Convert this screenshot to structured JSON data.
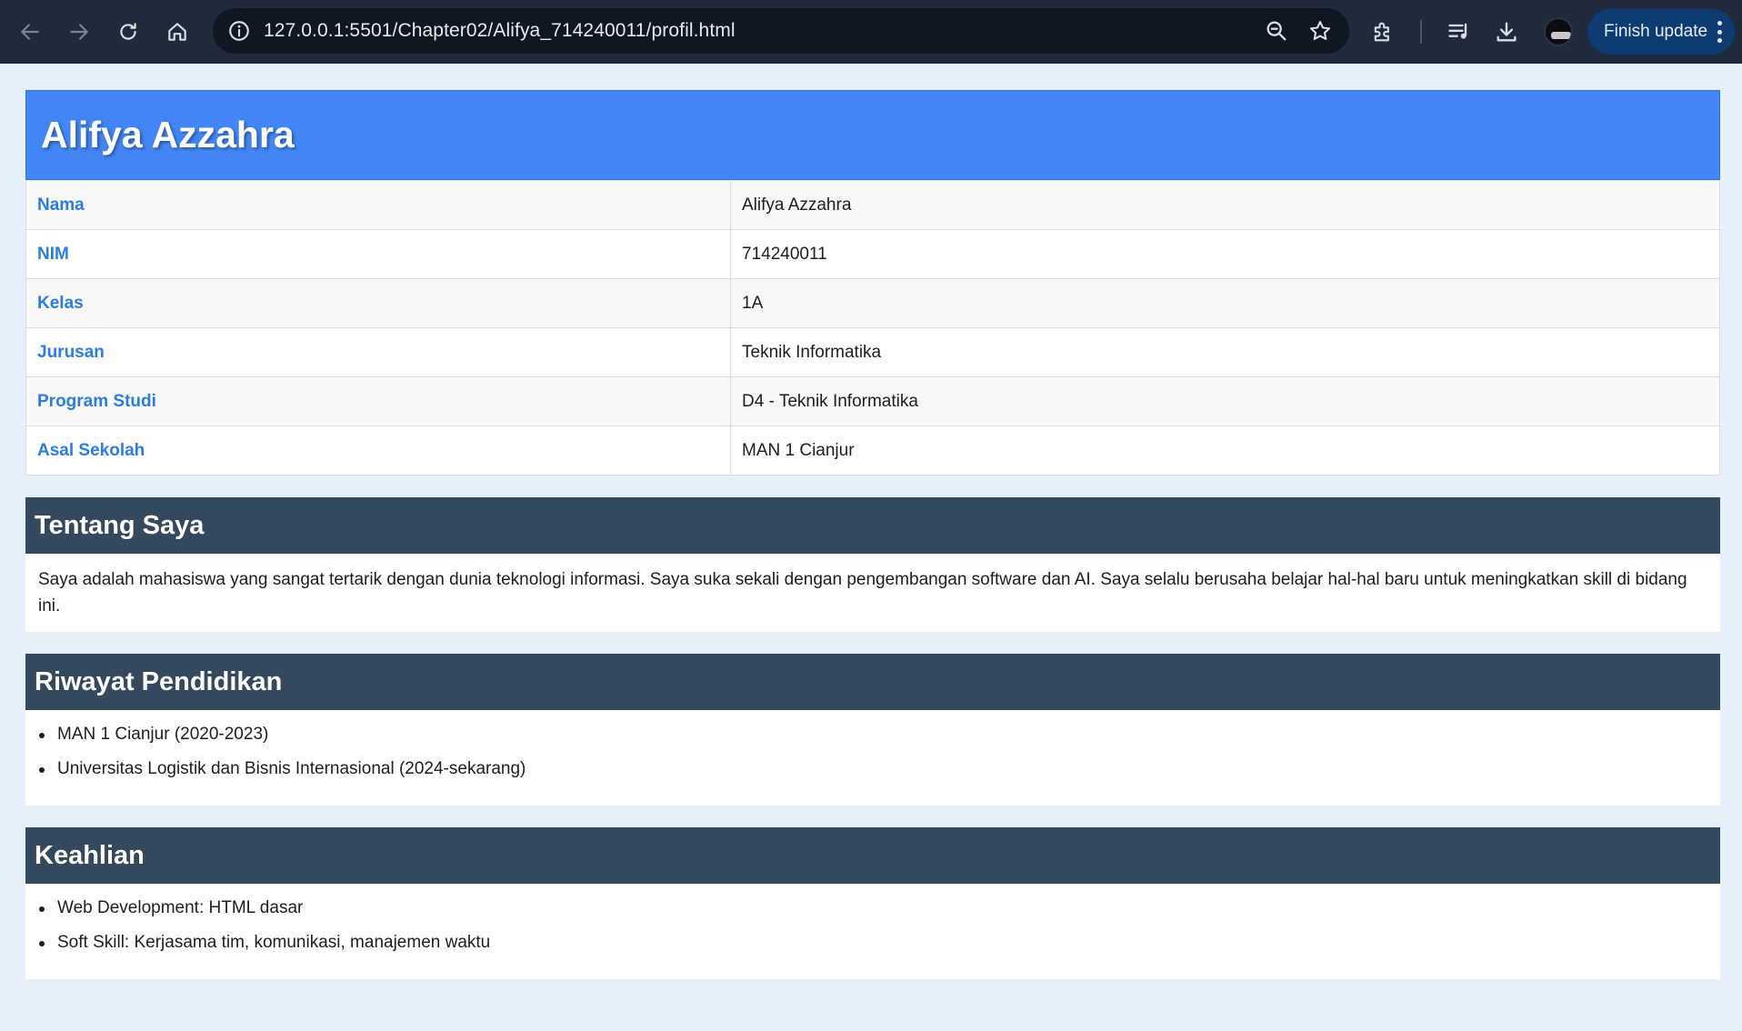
{
  "browser": {
    "url": "127.0.0.1:5501/Chapter02/Alifya_714240011/profil.html",
    "update_label": "Finish update"
  },
  "profile": {
    "title": "Alifya Azzahra",
    "rows": [
      {
        "label": "Nama",
        "value": "Alifya Azzahra"
      },
      {
        "label": "NIM",
        "value": "714240011"
      },
      {
        "label": "Kelas",
        "value": "1A"
      },
      {
        "label": "Jurusan",
        "value": "Teknik Informatika"
      },
      {
        "label": "Program Studi",
        "value": "D4 - Teknik Informatika"
      },
      {
        "label": "Asal Sekolah",
        "value": "MAN 1 Cianjur"
      }
    ]
  },
  "about": {
    "heading": "Tentang Saya",
    "text": "Saya adalah mahasiswa yang sangat tertarik dengan dunia teknologi informasi. Saya suka sekali dengan pengembangan software dan AI. Saya selalu berusaha belajar hal-hal baru untuk meningkatkan skill di bidang ini."
  },
  "education": {
    "heading": "Riwayat Pendidikan",
    "items": [
      "MAN 1 Cianjur (2020-2023)",
      "Universitas Logistik dan Bisnis Internasional (2024-sekarang)"
    ]
  },
  "skills": {
    "heading": "Keahlian",
    "items": [
      "Web Development: HTML dasar",
      "Soft Skill: Kerjasama tim, komunikasi, manajemen waktu"
    ]
  },
  "colors": {
    "header_bg": "#4286f5",
    "section_head_bg": "#34495e",
    "label_text": "#2b7de0",
    "page_bg": "#e6f0fb",
    "chrome_bg": "#1f2a3a"
  },
  "icons": [
    "back-arrow-icon",
    "forward-arrow-icon",
    "reload-icon",
    "home-icon",
    "site-info-icon",
    "zoom-icon",
    "bookmark-star-icon",
    "extensions-icon",
    "media-playlist-icon",
    "download-icon",
    "kebab-menu-icon"
  ]
}
